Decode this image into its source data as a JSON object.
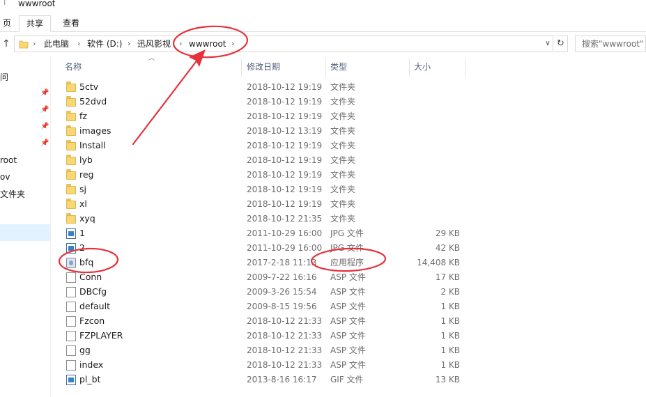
{
  "window": {
    "title": "wwwroot",
    "quick_access": "⊤"
  },
  "ribbon": {
    "tabs": [
      "页",
      "共享",
      "查看"
    ],
    "active_tab": "共享"
  },
  "address": {
    "crumbs": [
      "此电脑",
      "软件 (D:)",
      "迅风影视",
      "wwwroot"
    ],
    "separator": "›",
    "up_glyph": "↑",
    "dropdown_glyph": "∨",
    "refresh_glyph": "↻"
  },
  "search": {
    "placeholder": "搜索\"wwwroot\""
  },
  "nav": {
    "items": [
      "问",
      "root",
      "ov",
      "文件夹"
    ],
    "pin_glyph": "📌"
  },
  "columns": {
    "name": "名称",
    "date": "修改日期",
    "type": "类型",
    "size": "大小"
  },
  "files": [
    {
      "name": "5ctv",
      "date": "2018-10-12 19:19",
      "type": "文件夹",
      "size": "",
      "icon": "folder-icon"
    },
    {
      "name": "52dvd",
      "date": "2018-10-12 19:19",
      "type": "文件夹",
      "size": "",
      "icon": "folder-icon"
    },
    {
      "name": "fz",
      "date": "2018-10-12 19:19",
      "type": "文件夹",
      "size": "",
      "icon": "folder-icon"
    },
    {
      "name": "images",
      "date": "2018-10-12 13:19",
      "type": "文件夹",
      "size": "",
      "icon": "folder-icon"
    },
    {
      "name": "Install",
      "date": "2018-10-12 19:19",
      "type": "文件夹",
      "size": "",
      "icon": "folder-icon"
    },
    {
      "name": "lyb",
      "date": "2018-10-12 19:19",
      "type": "文件夹",
      "size": "",
      "icon": "folder-icon"
    },
    {
      "name": "reg",
      "date": "2018-10-12 19:19",
      "type": "文件夹",
      "size": "",
      "icon": "folder-icon"
    },
    {
      "name": "sj",
      "date": "2018-10-12 19:19",
      "type": "文件夹",
      "size": "",
      "icon": "folder-icon"
    },
    {
      "name": "xl",
      "date": "2018-10-12 19:19",
      "type": "文件夹",
      "size": "",
      "icon": "folder-icon"
    },
    {
      "name": "xyq",
      "date": "2018-10-12 21:35",
      "type": "文件夹",
      "size": "",
      "icon": "folder-icon"
    },
    {
      "name": "1",
      "date": "2011-10-29 16:00",
      "type": "JPG 文件",
      "size": "29 KB",
      "icon": "image-file-icon"
    },
    {
      "name": "2",
      "date": "2011-10-29 16:00",
      "type": "JPG 文件",
      "size": "42 KB",
      "icon": "image-file-icon"
    },
    {
      "name": "bfq",
      "date": "2017-2-18 11:13",
      "type": "应用程序",
      "size": "14,408 KB",
      "icon": "application-icon"
    },
    {
      "name": "Conn",
      "date": "2009-7-22 16:16",
      "type": "ASP 文件",
      "size": "17 KB",
      "icon": "document-icon"
    },
    {
      "name": "DBCfg",
      "date": "2009-3-26 15:54",
      "type": "ASP 文件",
      "size": "2 KB",
      "icon": "document-icon"
    },
    {
      "name": "default",
      "date": "2009-8-15 19:56",
      "type": "ASP 文件",
      "size": "1 KB",
      "icon": "document-icon"
    },
    {
      "name": "Fzcon",
      "date": "2018-10-12 21:33",
      "type": "ASP 文件",
      "size": "1 KB",
      "icon": "document-icon"
    },
    {
      "name": "FZPLAYER",
      "date": "2018-10-12 21:33",
      "type": "ASP 文件",
      "size": "1 KB",
      "icon": "document-icon"
    },
    {
      "name": "gg",
      "date": "2018-10-12 21:33",
      "type": "ASP 文件",
      "size": "1 KB",
      "icon": "document-icon"
    },
    {
      "name": "index",
      "date": "2018-10-12 21:33",
      "type": "ASP 文件",
      "size": "1 KB",
      "icon": "document-icon"
    },
    {
      "name": "pl_bt",
      "date": "2013-8-16 16:17",
      "type": "GIF 文件",
      "size": "13 KB",
      "icon": "image-file-icon"
    }
  ],
  "annotation": {
    "color": "#e8303a"
  }
}
